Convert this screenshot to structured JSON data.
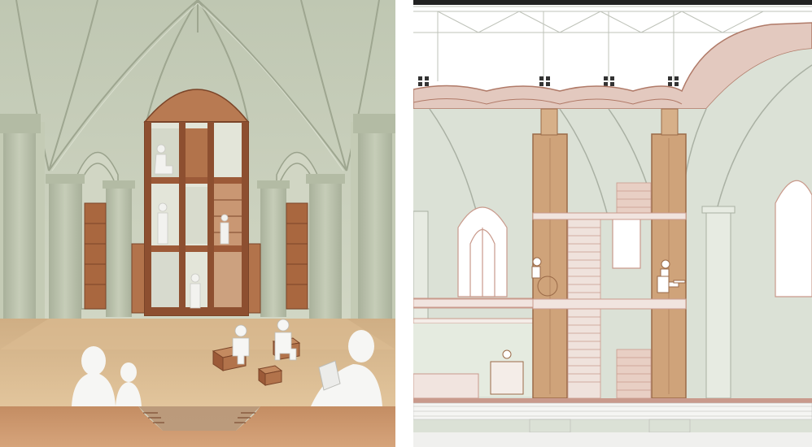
{
  "figure": {
    "panels": [
      {
        "id": "perspective",
        "kind": "interior-perspective-rendering"
      },
      {
        "id": "section",
        "kind": "architectural-section-drawing"
      }
    ]
  },
  "palette": {
    "vault": "#c9d0bd",
    "vault_light": "#dfe3d4",
    "rib": "#a6ae98",
    "stone_column": "#b8c0aa",
    "floor": "#d9b98f",
    "floor_shadow": "#c9a479",
    "timber": "#9c5a38",
    "timber_light": "#c68a62",
    "glass": "#e9ebe0",
    "deck": "#c8936a",
    "figure_fill": "#f4f4f2",
    "line_red": "#c99a8c",
    "cork": "#cfa37a",
    "section_wall": "#dbe1d6",
    "section_line": "#8f958a"
  }
}
